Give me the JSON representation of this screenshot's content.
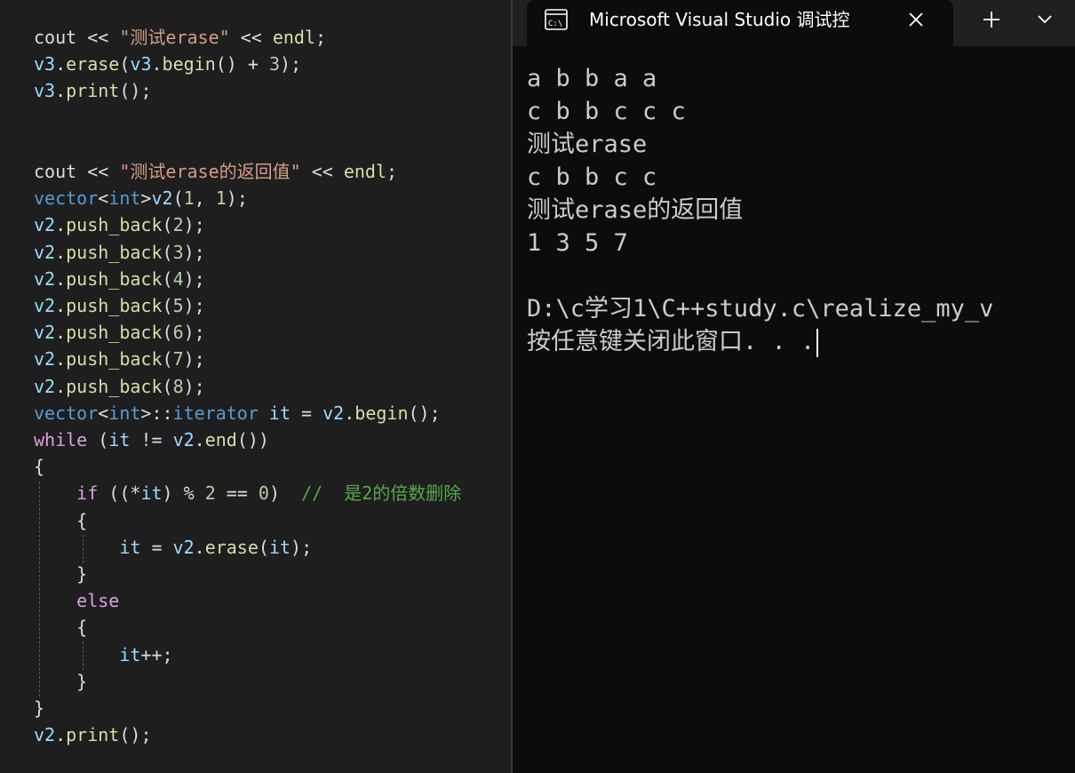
{
  "colors": {
    "editor_bg": "#1e1e1e",
    "default": "#dcdcdc",
    "string": "#d69d85",
    "type": "#569cd6",
    "method": "#dcdcaa",
    "variable": "#9cdcfe",
    "keyword": "#d8a0df",
    "number": "#b5cea8",
    "comment": "#57a64a",
    "terminal_bg": "#0c0c0c",
    "terminal_text": "#cccccc"
  },
  "editor": {
    "lines": [
      [
        [
          "cout ",
          "default"
        ],
        [
          "<<",
          "default"
        ],
        [
          " ",
          "default"
        ],
        [
          "\"测试erase\"",
          "string"
        ],
        [
          " << ",
          "default"
        ],
        [
          "endl",
          "method"
        ],
        [
          ";",
          "default"
        ]
      ],
      [
        [
          "v3",
          "variable"
        ],
        [
          ".",
          "default"
        ],
        [
          "erase",
          "method"
        ],
        [
          "(",
          "default"
        ],
        [
          "v3",
          "variable"
        ],
        [
          ".",
          "default"
        ],
        [
          "begin",
          "method"
        ],
        [
          "() + ",
          "default"
        ],
        [
          "3",
          "number"
        ],
        [
          ");",
          "default"
        ]
      ],
      [
        [
          "v3",
          "variable"
        ],
        [
          ".",
          "default"
        ],
        [
          "print",
          "method"
        ],
        [
          "();",
          "default"
        ]
      ],
      [],
      [],
      [
        [
          "cout ",
          "default"
        ],
        [
          "<<",
          "default"
        ],
        [
          " ",
          "default"
        ],
        [
          "\"测试erase的返回值\"",
          "string"
        ],
        [
          " << ",
          "default"
        ],
        [
          "endl",
          "method"
        ],
        [
          ";",
          "default"
        ]
      ],
      [
        [
          "vector",
          "type"
        ],
        [
          "<",
          "default"
        ],
        [
          "int",
          "type"
        ],
        [
          ">",
          "default"
        ],
        [
          "v2",
          "variable"
        ],
        [
          "(",
          "default"
        ],
        [
          "1",
          "number"
        ],
        [
          ", ",
          "default"
        ],
        [
          "1",
          "number"
        ],
        [
          ");",
          "default"
        ]
      ],
      [
        [
          "v2",
          "variable"
        ],
        [
          ".",
          "default"
        ],
        [
          "push_back",
          "method"
        ],
        [
          "(",
          "default"
        ],
        [
          "2",
          "number"
        ],
        [
          ");",
          "default"
        ]
      ],
      [
        [
          "v2",
          "variable"
        ],
        [
          ".",
          "default"
        ],
        [
          "push_back",
          "method"
        ],
        [
          "(",
          "default"
        ],
        [
          "3",
          "number"
        ],
        [
          ");",
          "default"
        ]
      ],
      [
        [
          "v2",
          "variable"
        ],
        [
          ".",
          "default"
        ],
        [
          "push_back",
          "method"
        ],
        [
          "(",
          "default"
        ],
        [
          "4",
          "number"
        ],
        [
          ");",
          "default"
        ]
      ],
      [
        [
          "v2",
          "variable"
        ],
        [
          ".",
          "default"
        ],
        [
          "push_back",
          "method"
        ],
        [
          "(",
          "default"
        ],
        [
          "5",
          "number"
        ],
        [
          ");",
          "default"
        ]
      ],
      [
        [
          "v2",
          "variable"
        ],
        [
          ".",
          "default"
        ],
        [
          "push_back",
          "method"
        ],
        [
          "(",
          "default"
        ],
        [
          "6",
          "number"
        ],
        [
          ");",
          "default"
        ]
      ],
      [
        [
          "v2",
          "variable"
        ],
        [
          ".",
          "default"
        ],
        [
          "push_back",
          "method"
        ],
        [
          "(",
          "default"
        ],
        [
          "7",
          "number"
        ],
        [
          ");",
          "default"
        ]
      ],
      [
        [
          "v2",
          "variable"
        ],
        [
          ".",
          "default"
        ],
        [
          "push_back",
          "method"
        ],
        [
          "(",
          "default"
        ],
        [
          "8",
          "number"
        ],
        [
          ");",
          "default"
        ]
      ],
      [
        [
          "vector",
          "type"
        ],
        [
          "<",
          "default"
        ],
        [
          "int",
          "type"
        ],
        [
          ">::",
          "default"
        ],
        [
          "iterator",
          "type"
        ],
        [
          " ",
          "default"
        ],
        [
          "it",
          "variable"
        ],
        [
          " = ",
          "default"
        ],
        [
          "v2",
          "variable"
        ],
        [
          ".",
          "default"
        ],
        [
          "begin",
          "method"
        ],
        [
          "();",
          "default"
        ]
      ],
      [
        [
          "while",
          "keyword"
        ],
        [
          " (",
          "default"
        ],
        [
          "it",
          "variable"
        ],
        [
          " != ",
          "default"
        ],
        [
          "v2",
          "variable"
        ],
        [
          ".",
          "default"
        ],
        [
          "end",
          "method"
        ],
        [
          "())",
          "default"
        ]
      ],
      [
        [
          "{",
          "default"
        ]
      ],
      [
        [
          "    ",
          "default"
        ],
        [
          "if",
          "keyword"
        ],
        [
          " ((*",
          "default"
        ],
        [
          "it",
          "variable"
        ],
        [
          ") % ",
          "default"
        ],
        [
          "2",
          "number"
        ],
        [
          " == ",
          "default"
        ],
        [
          "0",
          "number"
        ],
        [
          ")  ",
          "default"
        ],
        [
          "//  是2的倍数删除",
          "comment"
        ]
      ],
      [
        [
          "    {",
          "default"
        ]
      ],
      [
        [
          "        ",
          "default"
        ],
        [
          "it",
          "variable"
        ],
        [
          " = ",
          "default"
        ],
        [
          "v2",
          "variable"
        ],
        [
          ".",
          "default"
        ],
        [
          "erase",
          "method"
        ],
        [
          "(",
          "default"
        ],
        [
          "it",
          "variable"
        ],
        [
          ");",
          "default"
        ]
      ],
      [
        [
          "    }",
          "default"
        ]
      ],
      [
        [
          "    ",
          "default"
        ],
        [
          "else",
          "keyword"
        ]
      ],
      [
        [
          "    {",
          "default"
        ]
      ],
      [
        [
          "        ",
          "default"
        ],
        [
          "it",
          "variable"
        ],
        [
          "++;",
          "default"
        ]
      ],
      [
        [
          "    }",
          "default"
        ]
      ],
      [
        [
          "}",
          "default"
        ]
      ],
      [
        [
          "v2",
          "variable"
        ],
        [
          ".",
          "default"
        ],
        [
          "print",
          "method"
        ],
        [
          "();",
          "default"
        ]
      ]
    ]
  },
  "terminal": {
    "tab_title": "Microsoft Visual Studio 调试控",
    "tab_icon": "terminal-app-icon",
    "close_icon": "close-icon",
    "new_tab_icon": "plus-icon",
    "dropdown_icon": "chevron-down-icon",
    "output": [
      "a b b a a",
      "c b b c c c",
      "测试erase",
      "c b b c c",
      "测试erase的返回值",
      "1 3 5 7",
      "",
      "D:\\c学习1\\C++study.c\\realize_my_v",
      "按任意键关闭此窗口. . ."
    ]
  }
}
